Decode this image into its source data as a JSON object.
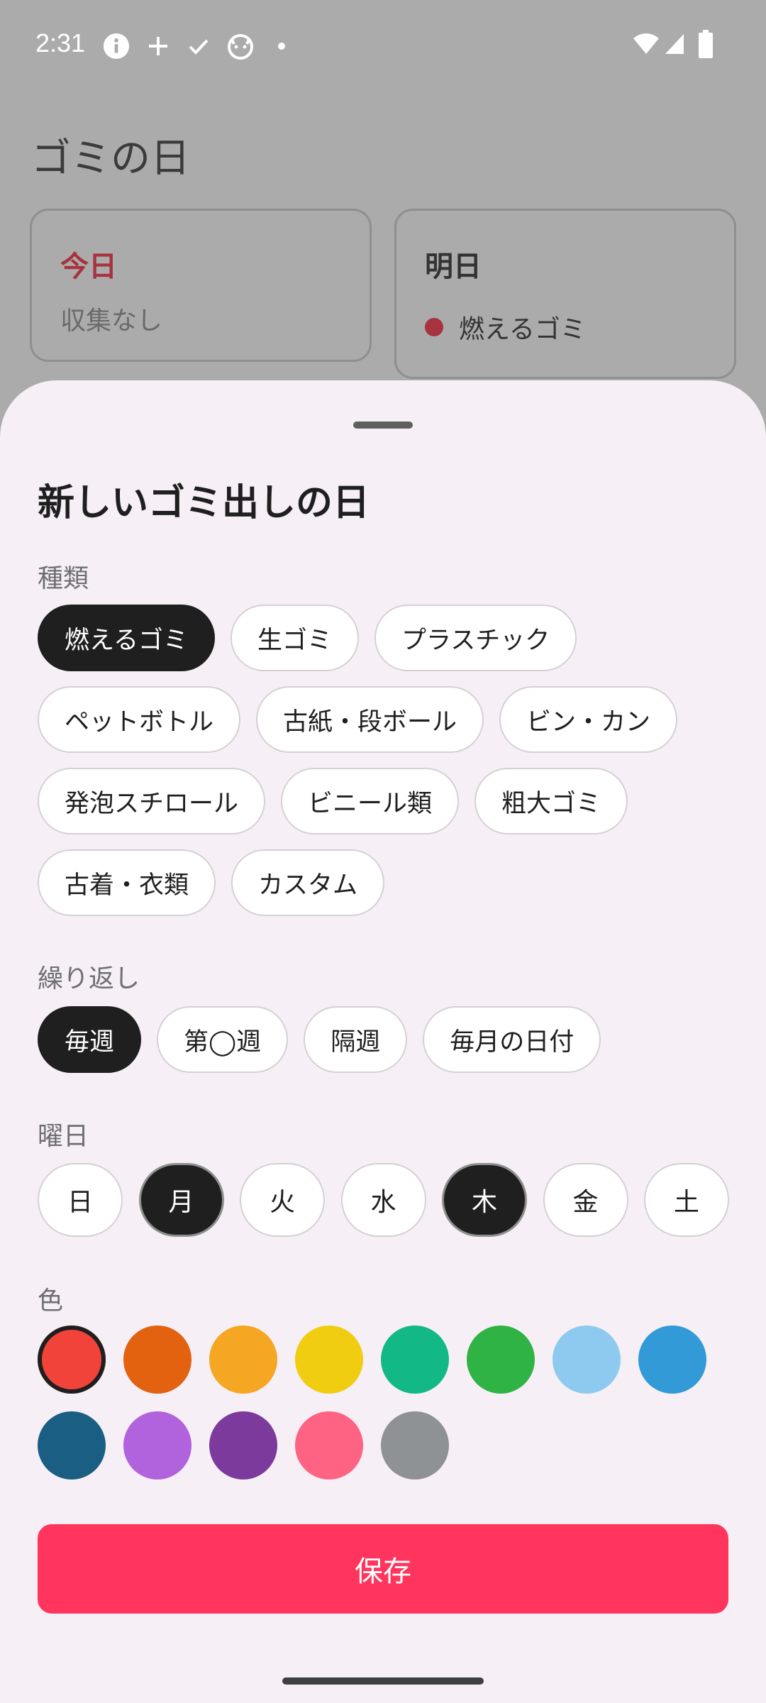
{
  "status_bar": {
    "time": "2:31",
    "left_icons": [
      "info-icon",
      "plus-icon",
      "check-icon",
      "cat-icon",
      "dot-icon"
    ],
    "right_icons": [
      "wifi-icon",
      "signal-icon",
      "battery-icon"
    ]
  },
  "background": {
    "title": "ゴミの日",
    "today": {
      "title": "今日",
      "body": "収集なし"
    },
    "tomorrow": {
      "title": "明日",
      "item": "燃えるゴミ",
      "dot_color": "#a8323e"
    }
  },
  "sheet": {
    "title": "新しいゴミ出しの日",
    "type_label": "種類",
    "types": [
      {
        "label": "燃えるゴミ",
        "selected": true
      },
      {
        "label": "生ゴミ",
        "selected": false
      },
      {
        "label": "プラスチック",
        "selected": false
      },
      {
        "label": "ペットボトル",
        "selected": false
      },
      {
        "label": "古紙・段ボール",
        "selected": false
      },
      {
        "label": "ビン・カン",
        "selected": false
      },
      {
        "label": "発泡スチロール",
        "selected": false
      },
      {
        "label": "ビニール類",
        "selected": false
      },
      {
        "label": "粗大ゴミ",
        "selected": false
      },
      {
        "label": "古着・衣類",
        "selected": false
      },
      {
        "label": "カスタム",
        "selected": false
      }
    ],
    "repeat_label": "繰り返し",
    "repeats": [
      {
        "label": "毎週",
        "selected": true
      },
      {
        "label": "第◯週",
        "selected": false
      },
      {
        "label": "隔週",
        "selected": false
      },
      {
        "label": "毎月の日付",
        "selected": false
      }
    ],
    "weekday_label": "曜日",
    "weekdays": [
      {
        "label": "日",
        "selected": false
      },
      {
        "label": "月",
        "selected": true
      },
      {
        "label": "火",
        "selected": false
      },
      {
        "label": "水",
        "selected": false
      },
      {
        "label": "木",
        "selected": true
      },
      {
        "label": "金",
        "selected": false
      },
      {
        "label": "土",
        "selected": false
      }
    ],
    "color_label": "色",
    "colors": [
      {
        "hex": "#f2433a",
        "selected": true
      },
      {
        "hex": "#e2620f",
        "selected": false
      },
      {
        "hex": "#f5a623",
        "selected": false
      },
      {
        "hex": "#f1cd11",
        "selected": false
      },
      {
        "hex": "#12b886",
        "selected": false
      },
      {
        "hex": "#2fb344",
        "selected": false
      },
      {
        "hex": "#8ecaf0",
        "selected": false
      },
      {
        "hex": "#329ad6",
        "selected": false
      },
      {
        "hex": "#1b5e83",
        "selected": false
      },
      {
        "hex": "#b063dc",
        "selected": false
      },
      {
        "hex": "#7b3a9c",
        "selected": false
      },
      {
        "hex": "#ff6383",
        "selected": false
      },
      {
        "hex": "#8f9294",
        "selected": false
      }
    ],
    "save_label": "保存",
    "accent_color": "#ff355d"
  }
}
